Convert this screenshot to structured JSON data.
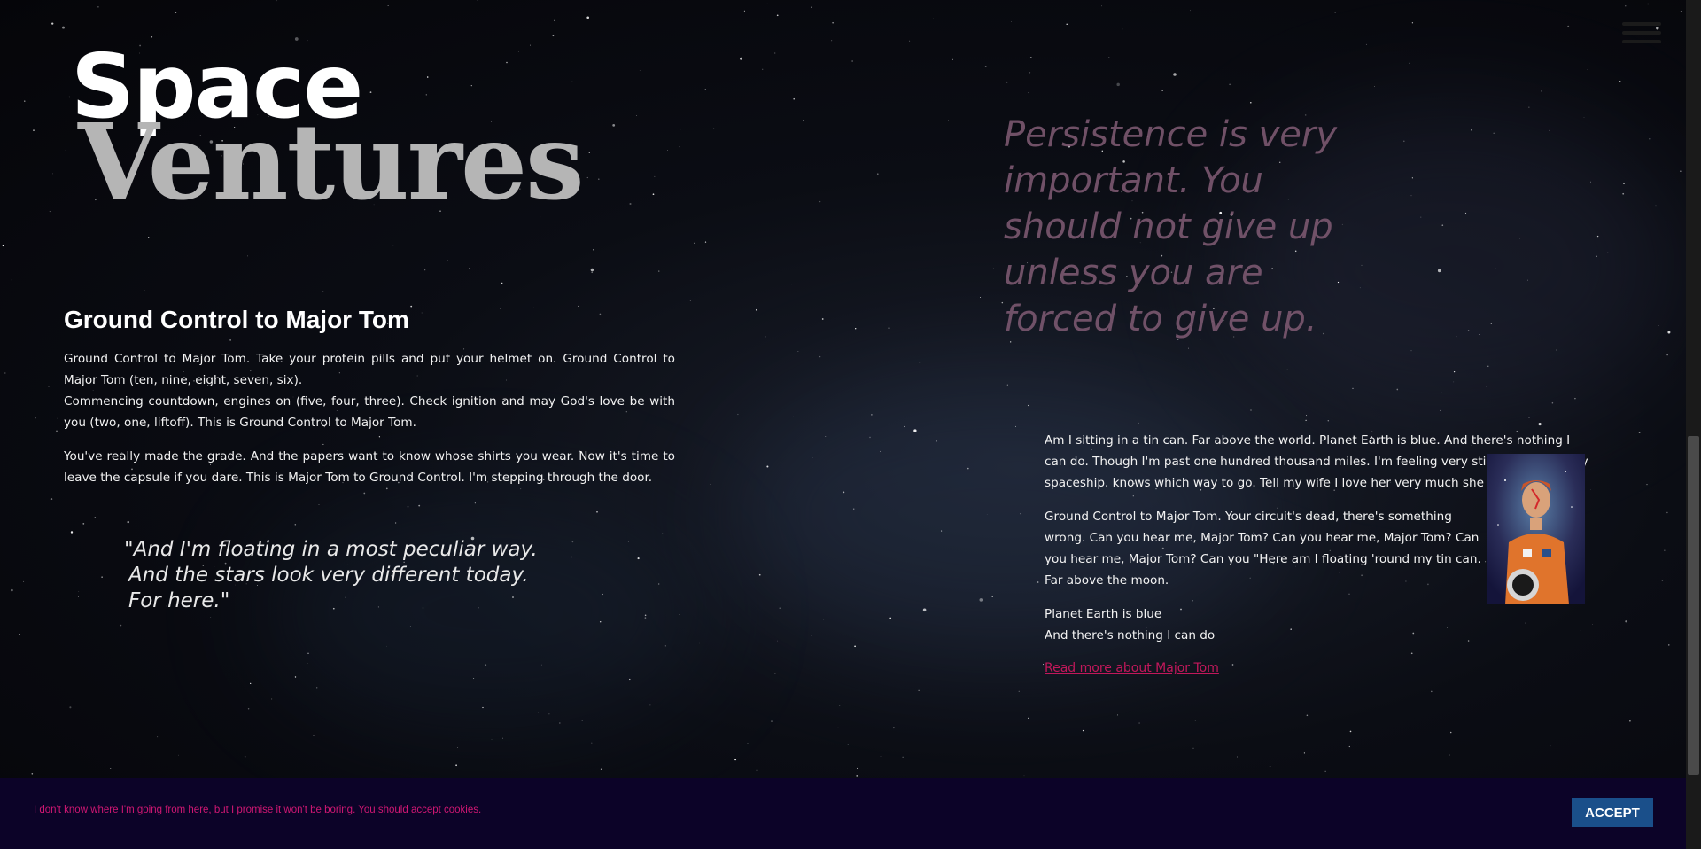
{
  "logo": {
    "line1": "Space",
    "line2": "Ventures"
  },
  "left": {
    "title": "Ground Control to Major Tom",
    "paragraph1a": "Ground Control to Major Tom. Take your protein pills and put your helmet on. Ground Control to Major Tom (ten, nine, eight, seven, six).",
    "paragraph1b": "Commencing countdown, engines on (five, four, three). Check ignition and may God's love be with you (two, one, liftoff). This is Ground Control to Major Tom.",
    "paragraph2": "You've really made the grade. And the papers want to know whose shirts you wear. Now it's time to leave the capsule if you dare. This is Major Tom to Ground Control. I'm stepping through the door."
  },
  "floating_quote": {
    "line1": "\"And I'm floating in a most peculiar way.",
    "line2": "And the stars look very different today.",
    "line3": "For here.\""
  },
  "persistence_quote": "Persistence is very important. You should not give up unless you are forced to give up.",
  "right": {
    "paragraph1": "Am I sitting in a tin can. Far above the world. Planet Earth is blue. And there's nothing I can do. Though I'm past one hundred thousand miles. I'm feeling very still. And I think my spaceship. knows which way to go. Tell my wife I love her very much she knows.",
    "paragraph2": "Ground Control to Major Tom. Your circuit's dead, there's something wrong. Can you hear me, Major Tom? Can you hear me, Major Tom? Can you hear me, Major Tom? Can you \"Here am I floating 'round my tin can. Far above the moon.",
    "line3": "Planet Earth is blue",
    "line4": "And there's nothing I can do",
    "read_more": "Read more about Major Tom"
  },
  "cookie": {
    "text": "I don't know where I'm going from here, but I promise it won't be boring. You should accept cookies.",
    "accept_label": "ACCEPT"
  },
  "icons": {
    "menu": "hamburger-menu-icon",
    "image": "astronaut-portrait"
  },
  "colors": {
    "accent": "#c2185b",
    "cookie_bg": "#0c0328",
    "button_bg": "#1a4f8a",
    "quote": "#7b5870"
  }
}
